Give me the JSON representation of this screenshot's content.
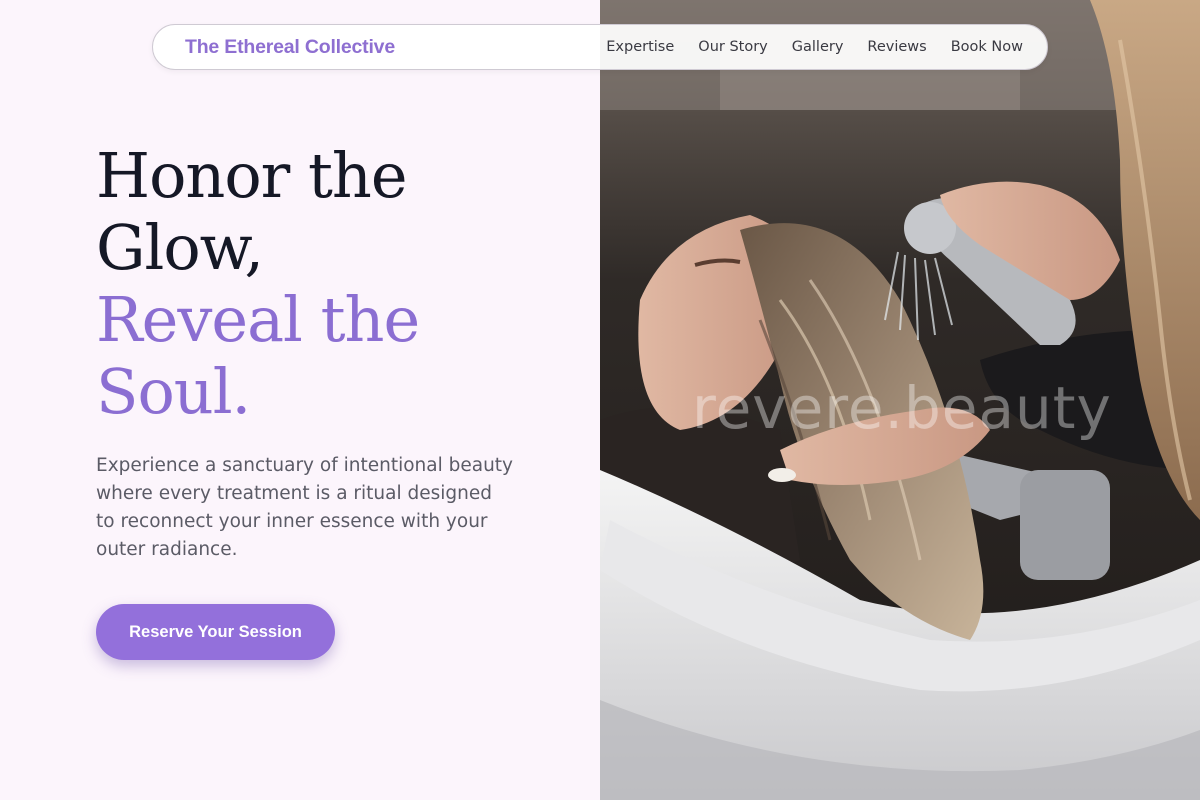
{
  "brand": {
    "name": "The Ethereal Collective"
  },
  "nav": {
    "items": [
      {
        "label": "Expertise"
      },
      {
        "label": "Our Story"
      },
      {
        "label": "Gallery"
      },
      {
        "label": "Reviews"
      },
      {
        "label": "Book Now"
      }
    ]
  },
  "hero": {
    "headline_line1": "Honor the",
    "headline_line2": "Glow,",
    "headline_line3": "Reveal the",
    "headline_line4": "Soul.",
    "description": "Experience a sanctuary of intentional beauty where every treatment is a ritual designed to reconnect your inner essence with your outer radiance.",
    "cta_label": "Reserve Your Session",
    "image_watermark": "revere.beauty",
    "image_alt": "Stylist washing a client's long hair at a salon basin"
  },
  "colors": {
    "accent": "#9370db",
    "headline_dark": "#151826",
    "left_background": "#fcf5fc",
    "body_text": "#5b5b66"
  }
}
